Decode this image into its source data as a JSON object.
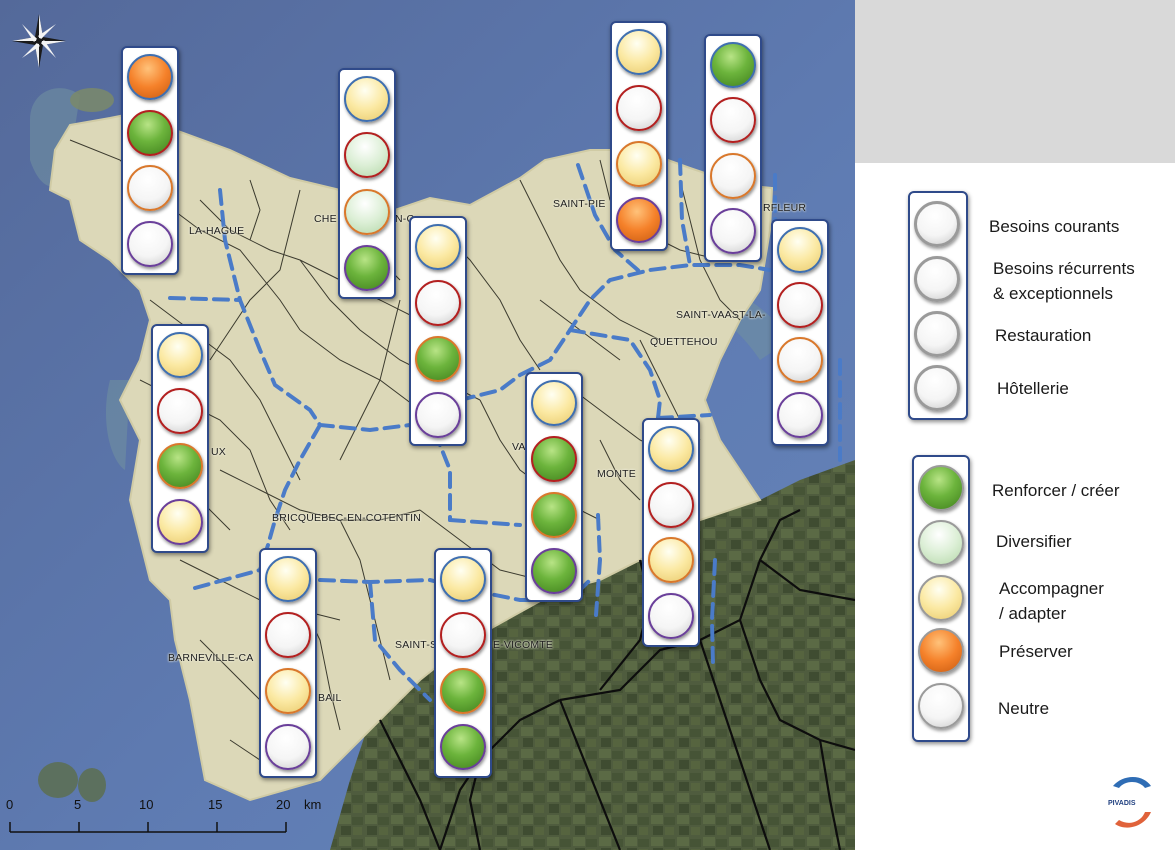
{
  "map": {
    "place_labels": [
      {
        "id": "la-hague",
        "text": "LA-HAGUE"
      },
      {
        "id": "cherbourg",
        "text": "CHE"
      },
      {
        "id": "cherbourg-2",
        "text": "N-C"
      },
      {
        "id": "saint-pierre",
        "text": "SAINT-PIE"
      },
      {
        "id": "barfleur",
        "text": "RFLEUR"
      },
      {
        "id": "saint-vaast",
        "text": "SAINT-VAAST-LA-"
      },
      {
        "id": "quettehou",
        "text": "QUETTEHOU"
      },
      {
        "id": "les-pieux",
        "text": "UX"
      },
      {
        "id": "valognes",
        "text": "VA"
      },
      {
        "id": "montebourg",
        "text": "MONTE"
      },
      {
        "id": "bricquebec",
        "text": "BRICQUEBEC-EN-COTENTIN"
      },
      {
        "id": "barneville",
        "text": "BARNEVILLE-CA"
      },
      {
        "id": "portbail",
        "text": "BAIL"
      },
      {
        "id": "saint-sauveur",
        "text": "SAINT-S"
      },
      {
        "id": "saint-sauveur-2",
        "text": "E-VICOMTE"
      }
    ],
    "indicators": [
      {
        "id": "la-hague",
        "balls": [
          "orange",
          "green",
          "white",
          "white"
        ]
      },
      {
        "id": "cherbourg",
        "balls": [
          "yellow",
          "lightgreen",
          "lightgreen",
          "green"
        ]
      },
      {
        "id": "valognes-north",
        "balls": [
          "yellow",
          "white",
          "green",
          "white"
        ]
      },
      {
        "id": "saint-pierre",
        "balls": [
          "yellow",
          "white",
          "yellow",
          "orange"
        ]
      },
      {
        "id": "barfleur",
        "balls": [
          "green",
          "white",
          "white",
          "white"
        ]
      },
      {
        "id": "saint-vaast",
        "balls": [
          "yellow",
          "white",
          "white",
          "white"
        ]
      },
      {
        "id": "les-pieux",
        "balls": [
          "yellow",
          "white",
          "green",
          "yellow"
        ]
      },
      {
        "id": "valognes",
        "balls": [
          "yellow",
          "green",
          "green",
          "green"
        ]
      },
      {
        "id": "montebourg",
        "balls": [
          "yellow",
          "white",
          "yellow",
          "white"
        ]
      },
      {
        "id": "portbail",
        "balls": [
          "yellow",
          "white",
          "yellow",
          "white"
        ]
      },
      {
        "id": "saint-sauveur",
        "balls": [
          "yellow",
          "white",
          "green",
          "green"
        ]
      }
    ],
    "scale": {
      "ticks": [
        "0",
        "5",
        "10",
        "15",
        "20"
      ],
      "unit": "km"
    }
  },
  "legend_rings": {
    "items": [
      {
        "id": "courants",
        "label": "Besoins courants"
      },
      {
        "id": "recurrents",
        "label": "Besoins récurrents\n& exceptionnels"
      },
      {
        "id": "restauration",
        "label": "Restauration"
      },
      {
        "id": "hotellerie",
        "label": "Hôtellerie"
      }
    ]
  },
  "legend_fills": {
    "items": [
      {
        "id": "green",
        "label": "Renforcer / créer"
      },
      {
        "id": "lightgreen",
        "label": "Diversifier"
      },
      {
        "id": "yellow",
        "label": "Accompagner\n/ adapter"
      },
      {
        "id": "orange",
        "label": "Préserver"
      },
      {
        "id": "white",
        "label": "Neutre"
      }
    ]
  },
  "logo": {
    "text": "PIVADIS"
  },
  "colors": {
    "sea": "#5a75a8",
    "land": "#dcd8b8",
    "inland": "#4d5a3c",
    "boundary_dash": "#4a7bc8",
    "frame": "#2f4a8a"
  }
}
